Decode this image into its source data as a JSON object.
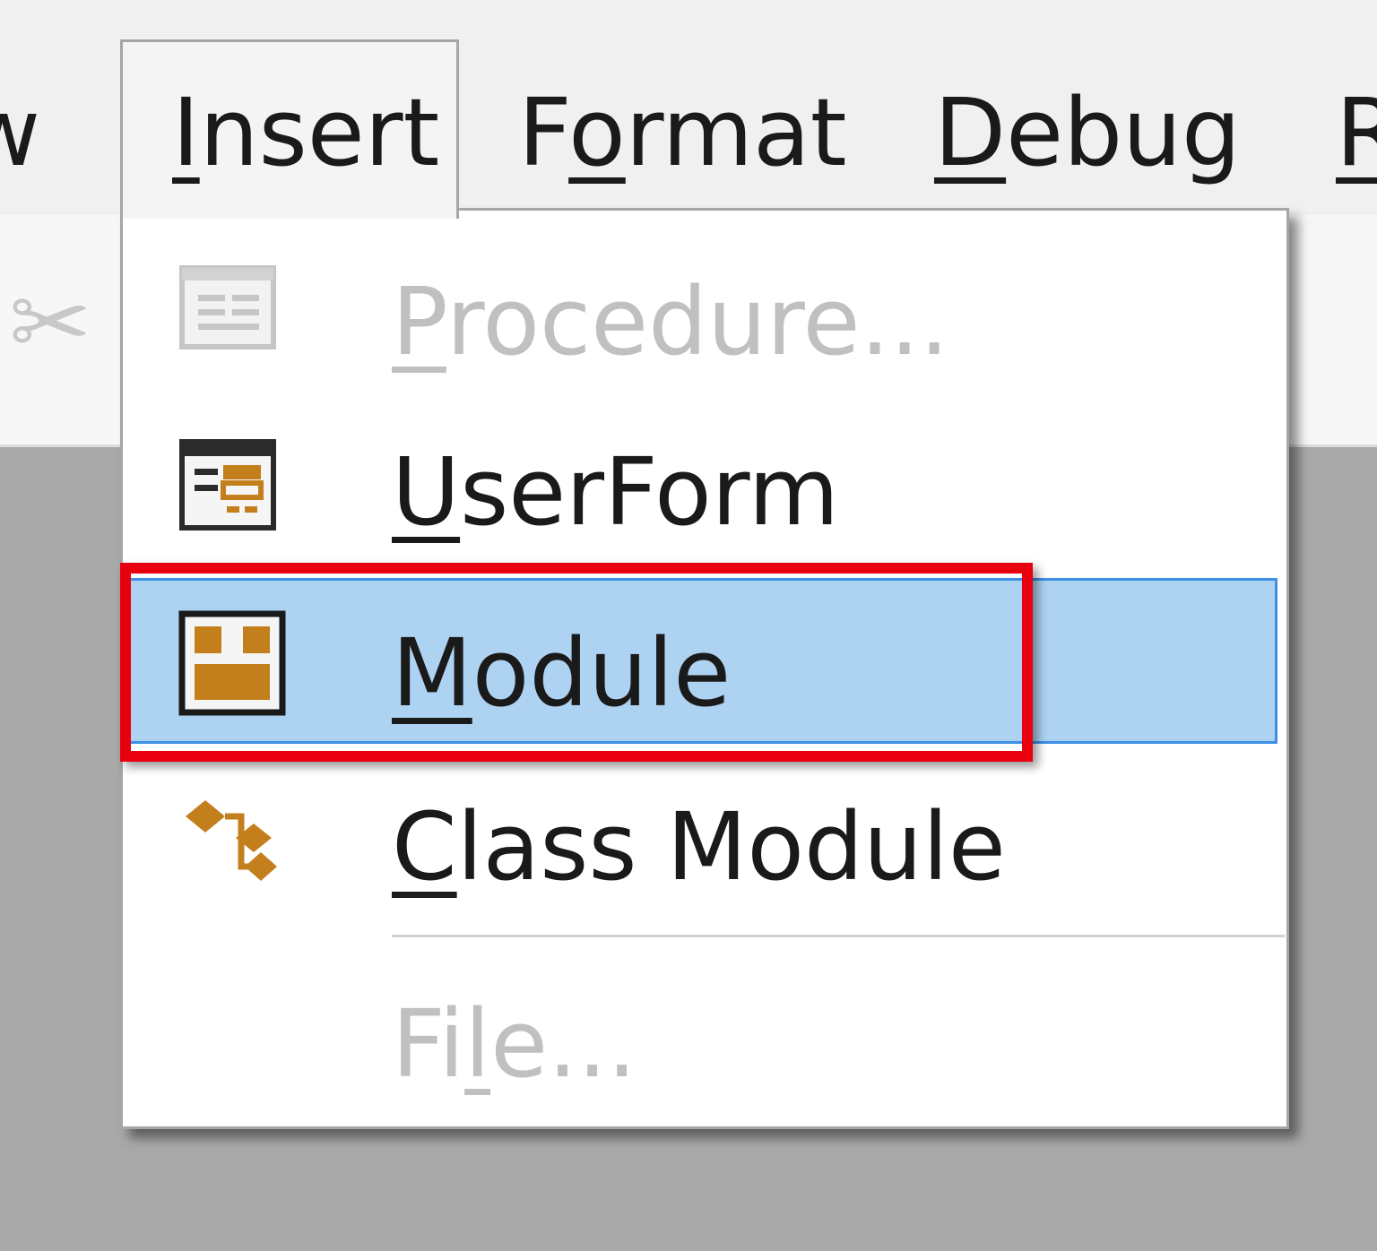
{
  "menubar": {
    "items": [
      {
        "label": "View",
        "mnemonic_part": "",
        "visible_text": "w"
      },
      {
        "label": "Insert",
        "pre": "",
        "mnemonic": "I",
        "post": "nsert"
      },
      {
        "label": "Format",
        "pre": "F",
        "mnemonic": "o",
        "post": "rmat"
      },
      {
        "label": "Debug",
        "pre": "",
        "mnemonic": "D",
        "post": "ebug"
      },
      {
        "label": "Run",
        "pre": "",
        "mnemonic": "R",
        "post": ""
      }
    ]
  },
  "dropdown": {
    "items": [
      {
        "label": "Procedure...",
        "pre": "",
        "mnemonic": "P",
        "post": "rocedure...",
        "icon": "procedure-icon",
        "enabled": false
      },
      {
        "label": "UserForm",
        "pre": "",
        "mnemonic": "U",
        "post": "serForm",
        "icon": "userform-icon",
        "enabled": true
      },
      {
        "label": "Module",
        "pre": "",
        "mnemonic": "M",
        "post": "odule",
        "icon": "module-icon",
        "enabled": true,
        "highlighted": true
      },
      {
        "label": "Class Module",
        "pre": "",
        "mnemonic": "C",
        "post": "lass Module",
        "icon": "class-module-icon",
        "enabled": true
      },
      {
        "label": "File...",
        "pre": "Fi",
        "mnemonic": "l",
        "post": "e...",
        "enabled": false
      }
    ]
  },
  "colors": {
    "highlight": "#aed3f2",
    "highlight_border": "#3c8ee6",
    "annotation": "#e8000f",
    "icon_accent": "#c47f1d"
  }
}
